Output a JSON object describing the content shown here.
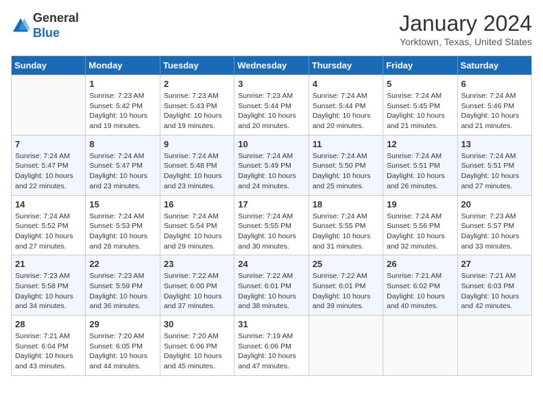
{
  "header": {
    "logo_line1": "General",
    "logo_line2": "Blue",
    "month_title": "January 2024",
    "location": "Yorktown, Texas, United States"
  },
  "weekdays": [
    "Sunday",
    "Monday",
    "Tuesday",
    "Wednesday",
    "Thursday",
    "Friday",
    "Saturday"
  ],
  "weeks": [
    [
      {
        "day": "",
        "sunrise": "",
        "sunset": "",
        "daylight": ""
      },
      {
        "day": "1",
        "sunrise": "Sunrise: 7:23 AM",
        "sunset": "Sunset: 5:42 PM",
        "daylight": "Daylight: 10 hours and 19 minutes."
      },
      {
        "day": "2",
        "sunrise": "Sunrise: 7:23 AM",
        "sunset": "Sunset: 5:43 PM",
        "daylight": "Daylight: 10 hours and 19 minutes."
      },
      {
        "day": "3",
        "sunrise": "Sunrise: 7:23 AM",
        "sunset": "Sunset: 5:44 PM",
        "daylight": "Daylight: 10 hours and 20 minutes."
      },
      {
        "day": "4",
        "sunrise": "Sunrise: 7:24 AM",
        "sunset": "Sunset: 5:44 PM",
        "daylight": "Daylight: 10 hours and 20 minutes."
      },
      {
        "day": "5",
        "sunrise": "Sunrise: 7:24 AM",
        "sunset": "Sunset: 5:45 PM",
        "daylight": "Daylight: 10 hours and 21 minutes."
      },
      {
        "day": "6",
        "sunrise": "Sunrise: 7:24 AM",
        "sunset": "Sunset: 5:46 PM",
        "daylight": "Daylight: 10 hours and 21 minutes."
      }
    ],
    [
      {
        "day": "7",
        "sunrise": "Sunrise: 7:24 AM",
        "sunset": "Sunset: 5:47 PM",
        "daylight": "Daylight: 10 hours and 22 minutes."
      },
      {
        "day": "8",
        "sunrise": "Sunrise: 7:24 AM",
        "sunset": "Sunset: 5:47 PM",
        "daylight": "Daylight: 10 hours and 23 minutes."
      },
      {
        "day": "9",
        "sunrise": "Sunrise: 7:24 AM",
        "sunset": "Sunset: 5:48 PM",
        "daylight": "Daylight: 10 hours and 23 minutes."
      },
      {
        "day": "10",
        "sunrise": "Sunrise: 7:24 AM",
        "sunset": "Sunset: 5:49 PM",
        "daylight": "Daylight: 10 hours and 24 minutes."
      },
      {
        "day": "11",
        "sunrise": "Sunrise: 7:24 AM",
        "sunset": "Sunset: 5:50 PM",
        "daylight": "Daylight: 10 hours and 25 minutes."
      },
      {
        "day": "12",
        "sunrise": "Sunrise: 7:24 AM",
        "sunset": "Sunset: 5:51 PM",
        "daylight": "Daylight: 10 hours and 26 minutes."
      },
      {
        "day": "13",
        "sunrise": "Sunrise: 7:24 AM",
        "sunset": "Sunset: 5:51 PM",
        "daylight": "Daylight: 10 hours and 27 minutes."
      }
    ],
    [
      {
        "day": "14",
        "sunrise": "Sunrise: 7:24 AM",
        "sunset": "Sunset: 5:52 PM",
        "daylight": "Daylight: 10 hours and 27 minutes."
      },
      {
        "day": "15",
        "sunrise": "Sunrise: 7:24 AM",
        "sunset": "Sunset: 5:53 PM",
        "daylight": "Daylight: 10 hours and 28 minutes."
      },
      {
        "day": "16",
        "sunrise": "Sunrise: 7:24 AM",
        "sunset": "Sunset: 5:54 PM",
        "daylight": "Daylight: 10 hours and 29 minutes."
      },
      {
        "day": "17",
        "sunrise": "Sunrise: 7:24 AM",
        "sunset": "Sunset: 5:55 PM",
        "daylight": "Daylight: 10 hours and 30 minutes."
      },
      {
        "day": "18",
        "sunrise": "Sunrise: 7:24 AM",
        "sunset": "Sunset: 5:55 PM",
        "daylight": "Daylight: 10 hours and 31 minutes."
      },
      {
        "day": "19",
        "sunrise": "Sunrise: 7:24 AM",
        "sunset": "Sunset: 5:56 PM",
        "daylight": "Daylight: 10 hours and 32 minutes."
      },
      {
        "day": "20",
        "sunrise": "Sunrise: 7:23 AM",
        "sunset": "Sunset: 5:57 PM",
        "daylight": "Daylight: 10 hours and 33 minutes."
      }
    ],
    [
      {
        "day": "21",
        "sunrise": "Sunrise: 7:23 AM",
        "sunset": "Sunset: 5:58 PM",
        "daylight": "Daylight: 10 hours and 34 minutes."
      },
      {
        "day": "22",
        "sunrise": "Sunrise: 7:23 AM",
        "sunset": "Sunset: 5:59 PM",
        "daylight": "Daylight: 10 hours and 36 minutes."
      },
      {
        "day": "23",
        "sunrise": "Sunrise: 7:22 AM",
        "sunset": "Sunset: 6:00 PM",
        "daylight": "Daylight: 10 hours and 37 minutes."
      },
      {
        "day": "24",
        "sunrise": "Sunrise: 7:22 AM",
        "sunset": "Sunset: 6:01 PM",
        "daylight": "Daylight: 10 hours and 38 minutes."
      },
      {
        "day": "25",
        "sunrise": "Sunrise: 7:22 AM",
        "sunset": "Sunset: 6:01 PM",
        "daylight": "Daylight: 10 hours and 39 minutes."
      },
      {
        "day": "26",
        "sunrise": "Sunrise: 7:21 AM",
        "sunset": "Sunset: 6:02 PM",
        "daylight": "Daylight: 10 hours and 40 minutes."
      },
      {
        "day": "27",
        "sunrise": "Sunrise: 7:21 AM",
        "sunset": "Sunset: 6:03 PM",
        "daylight": "Daylight: 10 hours and 42 minutes."
      }
    ],
    [
      {
        "day": "28",
        "sunrise": "Sunrise: 7:21 AM",
        "sunset": "Sunset: 6:04 PM",
        "daylight": "Daylight: 10 hours and 43 minutes."
      },
      {
        "day": "29",
        "sunrise": "Sunrise: 7:20 AM",
        "sunset": "Sunset: 6:05 PM",
        "daylight": "Daylight: 10 hours and 44 minutes."
      },
      {
        "day": "30",
        "sunrise": "Sunrise: 7:20 AM",
        "sunset": "Sunset: 6:06 PM",
        "daylight": "Daylight: 10 hours and 45 minutes."
      },
      {
        "day": "31",
        "sunrise": "Sunrise: 7:19 AM",
        "sunset": "Sunset: 6:06 PM",
        "daylight": "Daylight: 10 hours and 47 minutes."
      },
      {
        "day": "",
        "sunrise": "",
        "sunset": "",
        "daylight": ""
      },
      {
        "day": "",
        "sunrise": "",
        "sunset": "",
        "daylight": ""
      },
      {
        "day": "",
        "sunrise": "",
        "sunset": "",
        "daylight": ""
      }
    ]
  ]
}
